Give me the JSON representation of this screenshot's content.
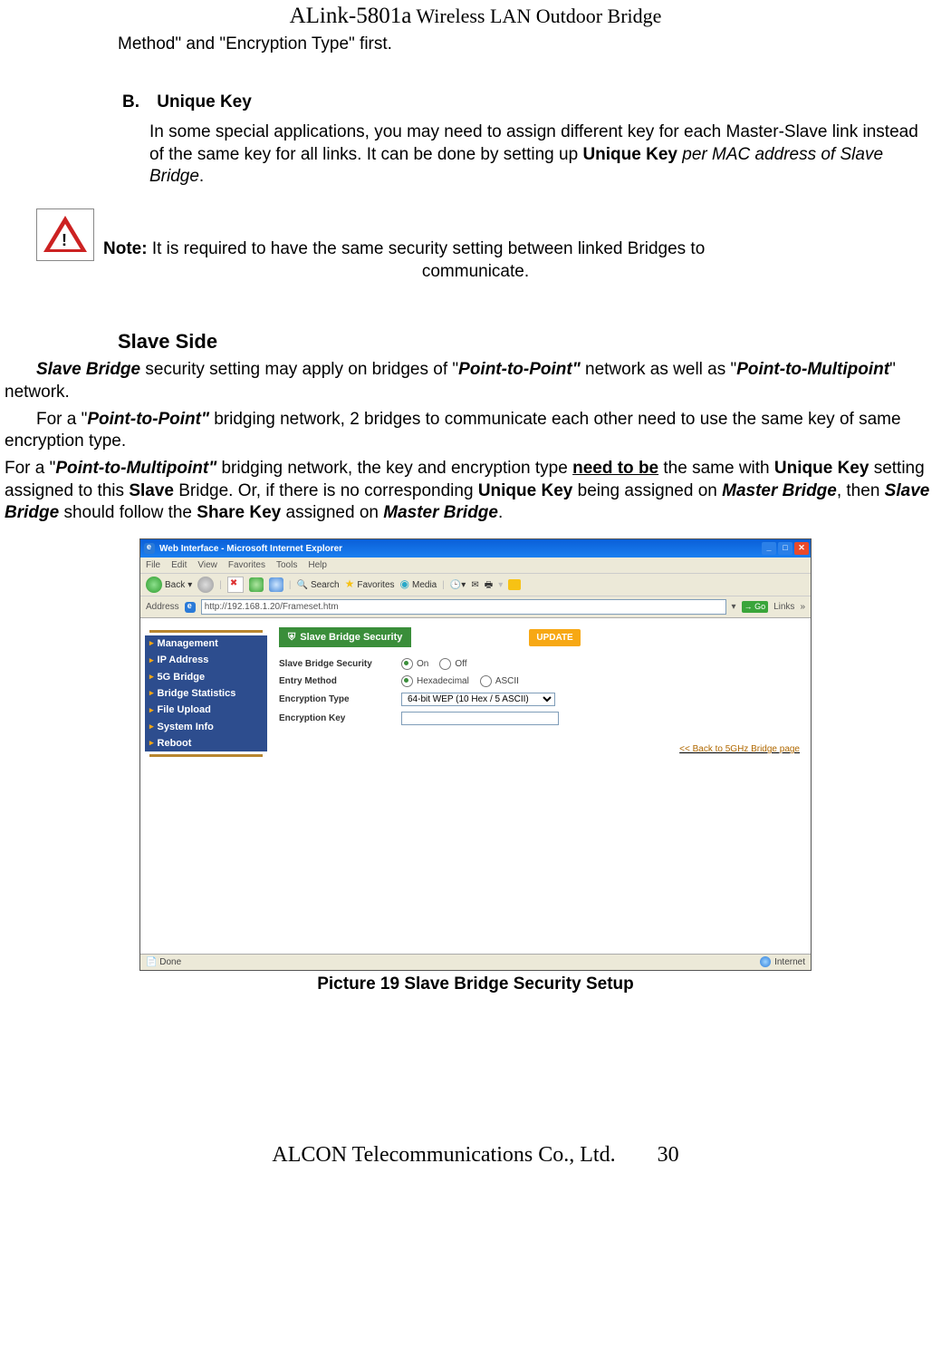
{
  "header": {
    "title_prefix": "ALink-5801a",
    "title_rest": " Wireless LAN Outdoor Bridge"
  },
  "continued_line": "Method\" and \"Encryption Type\" first.",
  "section_b": {
    "letter": "B.",
    "title": "Unique Key",
    "body_pre": "In some special applications, you may need to assign different key for each Master-Slave link instead of the same key for all links.    It can be done by setting up ",
    "body_bold": "Unique Key",
    "body_italic": " per MAC address of Slave Bridge",
    "body_end": "."
  },
  "note": {
    "label": "Note:",
    "text_line1": " It is required to have the same security setting between linked Bridges to",
    "text_line2": "communicate."
  },
  "slave_heading": "Slave Side",
  "para1": {
    "p1": "Slave Bridge",
    "p2": " security setting may apply on bridges of \"",
    "p3": "Point-to-Point\"",
    "p4": " network as well as \"",
    "p5": "Point-to-Multipoint",
    "p6": "\" network."
  },
  "para2": {
    "p1": "For a \"",
    "p2": "Point-to-Point\"",
    "p3": " bridging network, 2 bridges to communicate each other need to use the same key of same encryption type."
  },
  "para3": {
    "p1": "For a \"",
    "p2": "Point-to-Multipoint\"",
    "p3": " bridging network, the key and encryption type ",
    "p4": "need to be",
    "p5": " the same with ",
    "p6": "Unique Key",
    "p7": " setting assigned to this ",
    "p8": "Slave",
    "p9": " Bridge. Or, if there is no corresponding ",
    "p10": "Unique Key",
    "p11": " being assigned on ",
    "p12": "Master Bridge",
    "p13": ", then ",
    "p14": "Slave Bridge",
    "p15": " should follow the ",
    "p16": "Share Key",
    "p17": " assigned on ",
    "p18": "Master Bridge",
    "p19": "."
  },
  "ie": {
    "title": "Web Interface - Microsoft Internet Explorer",
    "menu": [
      "File",
      "Edit",
      "View",
      "Favorites",
      "Tools",
      "Help"
    ],
    "back": "Back",
    "search": "Search",
    "favorites": "Favorites",
    "media": "Media",
    "address_label": "Address",
    "address": "http://192.168.1.20/Frameset.htm",
    "go": "Go",
    "links": "Links",
    "sidebar": [
      "Management",
      "IP Address",
      "5G Bridge",
      "Bridge Statistics",
      "File Upload",
      "System Info",
      "Reboot"
    ],
    "panel_title": "Slave Bridge Security",
    "update": "UPDATE",
    "rows": {
      "r1_label": "Slave Bridge Security",
      "r1_on": "On",
      "r1_off": "Off",
      "r2_label": "Entry Method",
      "r2_hex": "Hexadecimal",
      "r2_ascii": "ASCII",
      "r3_label": "Encryption Type",
      "r3_value": "64-bit WEP (10 Hex / 5 ASCII)",
      "r4_label": "Encryption Key"
    },
    "backlink": "<< Back to 5GHz Bridge page",
    "status_done": "Done",
    "status_zone": "Internet"
  },
  "caption": "Picture 19 Slave Bridge Security Setup",
  "footer": {
    "company": "ALCON Telecommunications Co., Ltd.",
    "page": "30"
  }
}
